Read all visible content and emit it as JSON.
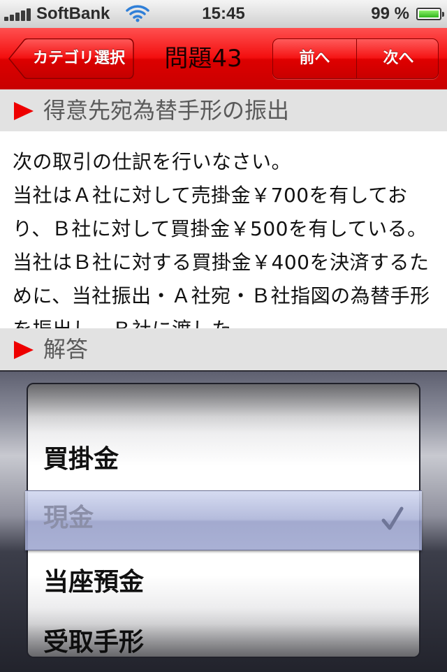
{
  "status_bar": {
    "carrier": "SoftBank",
    "time": "15:45",
    "battery_percent": "99 %",
    "battery_level": 0.99,
    "icons": [
      "signal-bars-icon",
      "wifi-icon",
      "battery-icon"
    ]
  },
  "nav": {
    "back_label": "カテゴリ選択",
    "title": "問題43",
    "prev_label": "前へ",
    "next_label": "次へ",
    "accent_color": "#e60000"
  },
  "question_section": {
    "title": "得意先宛為替手形の振出",
    "text": "次の取引の仕訳を行いなさい。\n当社はＡ社に対して売掛金￥700を有しており、Ｂ社に対して買掛金￥500を有している。当社はＢ社に対する買掛金￥400を決済するために、当社振出・Ａ社宛・Ｂ社指図の為替手形を振出し、Ｂ社に渡した。"
  },
  "answer_section": {
    "title": "解答"
  },
  "picker": {
    "items": [
      "買掛金",
      "現金",
      "当座預金",
      "受取手形"
    ],
    "selected": "現金"
  }
}
